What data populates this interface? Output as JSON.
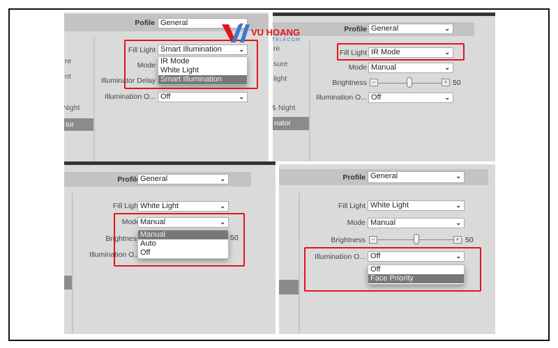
{
  "watermark": {
    "brand": "VU HOANG",
    "sub": "TELECOM"
  },
  "colors": {
    "highlight_box": "#e0141b",
    "selected_option": "#787878",
    "panel_bg": "#dadada"
  },
  "panel1": {
    "profile_label": "Pofile",
    "profile_value": "General",
    "sidebar": [
      "re",
      "nt",
      "Night",
      "tor"
    ],
    "fill_light_label": "Fill Light",
    "fill_light_value": "Smart Illumination",
    "fill_light_options": [
      "IR Mode",
      "White Light",
      "Smart Illumination"
    ],
    "mode_label": "Mode",
    "illuminator_delay_label": "Illuminator Delay",
    "illumination_label": "Illumination O...",
    "illumination_value": "Off"
  },
  "panel2": {
    "profile_label": "Profile",
    "profile_value": "General",
    "sidebar": [
      "re",
      "sure",
      "light",
      "& Night",
      "nator"
    ],
    "fill_light_label": "Fill Light",
    "fill_light_value": "IR Mode",
    "mode_label": "Mode",
    "mode_value": "Manual",
    "brightness_label": "Brightness",
    "brightness_value": "50",
    "illumination_label": "Illumination O...",
    "illumination_value": "Off"
  },
  "panel3": {
    "profile_label": "Profile",
    "profile_value": "General",
    "fill_light_label": "Fill Light",
    "fill_light_value": "White Light",
    "mode_label": "Mode",
    "mode_value": "Manual",
    "mode_options": [
      "Manual",
      "Auto",
      "Off"
    ],
    "brightness_label": "Brightness",
    "brightness_value": "50",
    "illumination_label": "Illumination O..."
  },
  "panel4": {
    "profile_label": "Profile",
    "profile_value": "General",
    "fill_light_label": "Fill Light",
    "fill_light_value": "White Light",
    "mode_label": "Mode",
    "mode_value": "Manual",
    "brightness_label": "Brightness",
    "brightness_value": "50",
    "illumination_label": "Illumination O...",
    "illumination_value": "Off",
    "illumination_options": [
      "Off",
      "Face Priority"
    ]
  },
  "icons": {
    "chevron": "chevron-down-icon",
    "minus": "−",
    "plus": "+"
  }
}
